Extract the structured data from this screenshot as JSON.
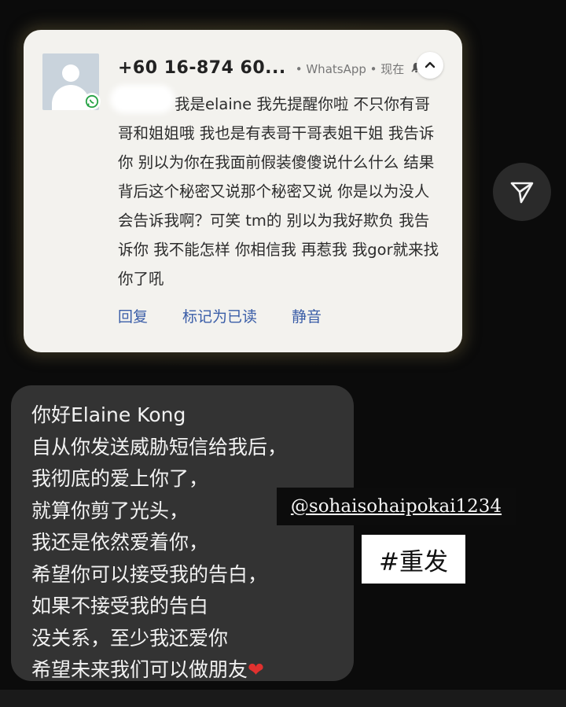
{
  "notification": {
    "phone": "+60 16-874 60...",
    "app": "• WhatsApp • 现在",
    "message": "我是elaine 我先提醒你啦 不只你有哥哥和姐姐哦 我也是有表哥干哥表姐干姐 我告诉你 别以为你在我面前假装傻傻说什么什么 结果背后这个秘密又说那个秘密又说 你是以为没人会告诉我啊？可笑 tm的 别以为我好欺负 我告诉你 我不能怎样 你相信我 再惹我 我gor就来找你了吼",
    "actions": [
      "回复",
      "标记为已读",
      "静音"
    ],
    "icons": {
      "avatar": "contact-avatar-icon",
      "badge": "whatsapp-icon",
      "bell": "bell-muted-icon",
      "collapse": "chevron-up-icon"
    }
  },
  "share": {
    "icon": "send-icon"
  },
  "reply": {
    "lines": [
      "你好Elaine Kong",
      "自从你发送威胁短信给我后，",
      "我彻底的爱上你了，",
      "就算你剪了光头，",
      "我还是依然爱着你，",
      "希望你可以接受我的告白，",
      "如果不接受我的告白",
      "没关系，至少我还爱你",
      "希望未来我们可以做朋友"
    ],
    "emoji": "❤"
  },
  "overlay": {
    "handle": "@sohaisohaipokai1234",
    "tag": "#重发"
  },
  "colors": {
    "link": "#3b5ea8",
    "bubble": "#333333",
    "card": "#f3f2ee"
  }
}
